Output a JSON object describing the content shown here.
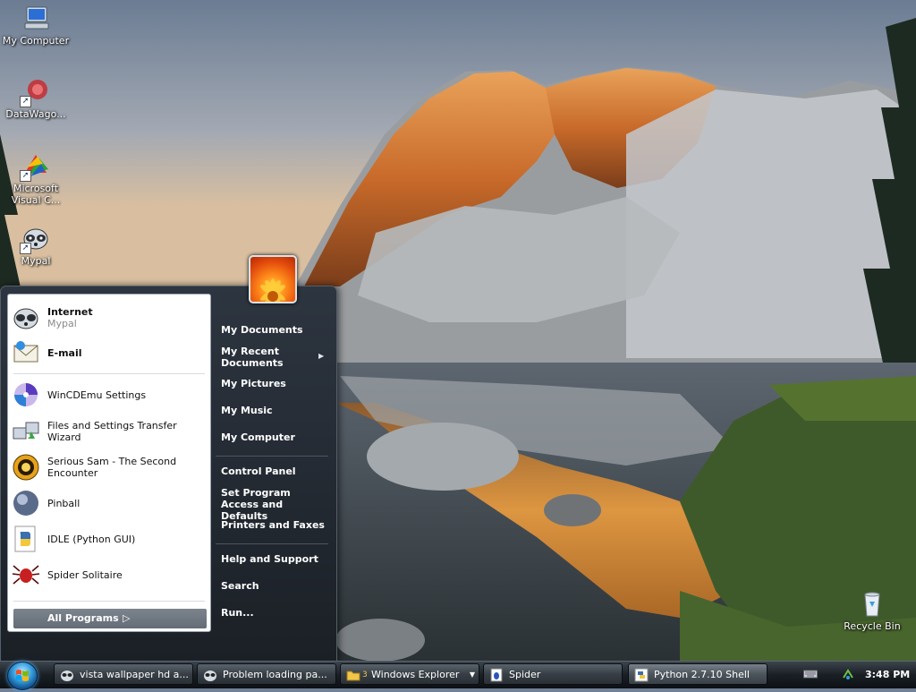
{
  "desktop": {
    "icons": [
      {
        "label": "My Computer"
      },
      {
        "label": "DataWago..."
      },
      {
        "label": "Microsoft Visual C..."
      },
      {
        "label": "Mypal"
      },
      {
        "label": "Recycle Bin"
      }
    ]
  },
  "start_menu": {
    "pinned": [
      {
        "label": "Internet",
        "sublabel": "Mypal"
      },
      {
        "label": "E-mail"
      }
    ],
    "recent": [
      {
        "label": "WinCDEmu Settings"
      },
      {
        "label": "Files and Settings Transfer Wizard"
      },
      {
        "label": "Serious Sam - The Second Encounter"
      },
      {
        "label": "Pinball"
      },
      {
        "label": "IDLE (Python GUI)"
      },
      {
        "label": "Spider Solitaire"
      }
    ],
    "all_programs": "All Programs",
    "right_items": [
      {
        "label": "My Documents"
      },
      {
        "label": "My Recent Documents"
      },
      {
        "label": "My Pictures"
      },
      {
        "label": "My Music"
      },
      {
        "label": "My Computer"
      },
      {
        "label": "Control Panel"
      },
      {
        "label": "Set Program Access and Defaults"
      },
      {
        "label": "Printers and Faxes"
      },
      {
        "label": "Help and Support"
      },
      {
        "label": "Search"
      },
      {
        "label": "Run..."
      }
    ]
  },
  "taskbar": {
    "buttons": [
      {
        "label": "vista wallpaper hd a..."
      },
      {
        "label": "Problem loading pa..."
      },
      {
        "label": "Windows Explorer",
        "count": "3"
      },
      {
        "label": "Spider"
      },
      {
        "label": "Python 2.7.10 Shell"
      }
    ],
    "clock": "3:48 PM"
  },
  "colors": {
    "taskbar": "#1a1f25",
    "menu_right": "#2d3540",
    "accent": "#3aa0e0"
  }
}
